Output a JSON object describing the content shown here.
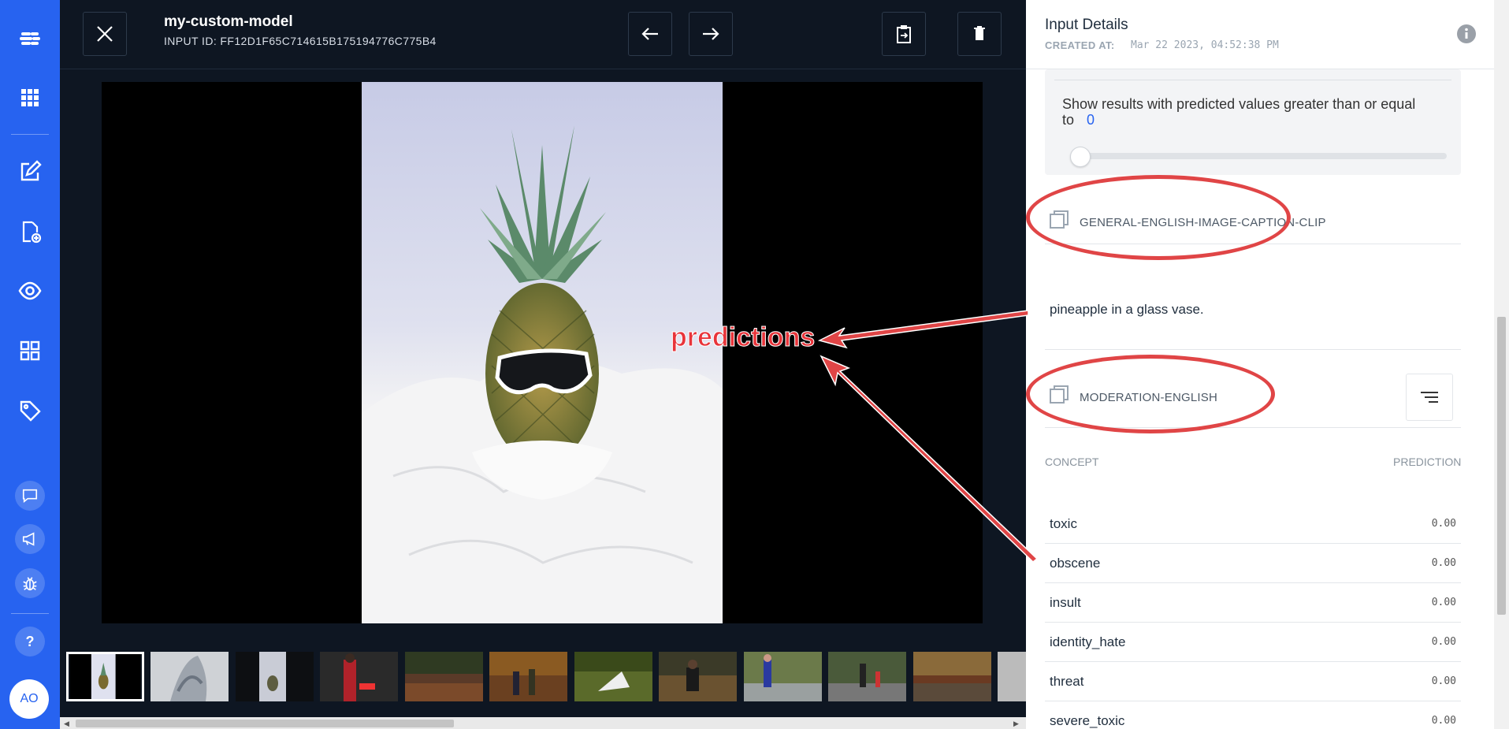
{
  "header": {
    "model_name": "my-custom-model",
    "input_id": "INPUT ID: FF12D1F65C714615B175194776C775B4"
  },
  "viewer": {
    "annotation_text": "predictions",
    "thumbnail_count": 12
  },
  "panel": {
    "title": "Input Details",
    "created_label": "CREATED AT:",
    "created_value": "Mar 22 2023, 04:52:38 PM",
    "threshold_text": "Show results with predicted values greater than or equal to",
    "threshold_value": "0",
    "models": [
      {
        "name": "GENERAL-ENGLISH-IMAGE-CAPTION-CLIP",
        "output": "pineapple in a glass vase."
      },
      {
        "name": "MODERATION-ENGLISH"
      }
    ],
    "columns": {
      "concept": "CONCEPT",
      "prediction": "PREDICTION"
    },
    "concepts": [
      {
        "name": "toxic",
        "value": "0.00"
      },
      {
        "name": "obscene",
        "value": "0.00"
      },
      {
        "name": "insult",
        "value": "0.00"
      },
      {
        "name": "identity_hate",
        "value": "0.00"
      },
      {
        "name": "threat",
        "value": "0.00"
      },
      {
        "name": "severe_toxic",
        "value": "0.00"
      }
    ]
  },
  "nav": {
    "avatar": "AO",
    "help": "?"
  },
  "colors": {
    "accent": "#2763f0",
    "annotation": "#e04546",
    "dark_bg": "#0e1622"
  }
}
